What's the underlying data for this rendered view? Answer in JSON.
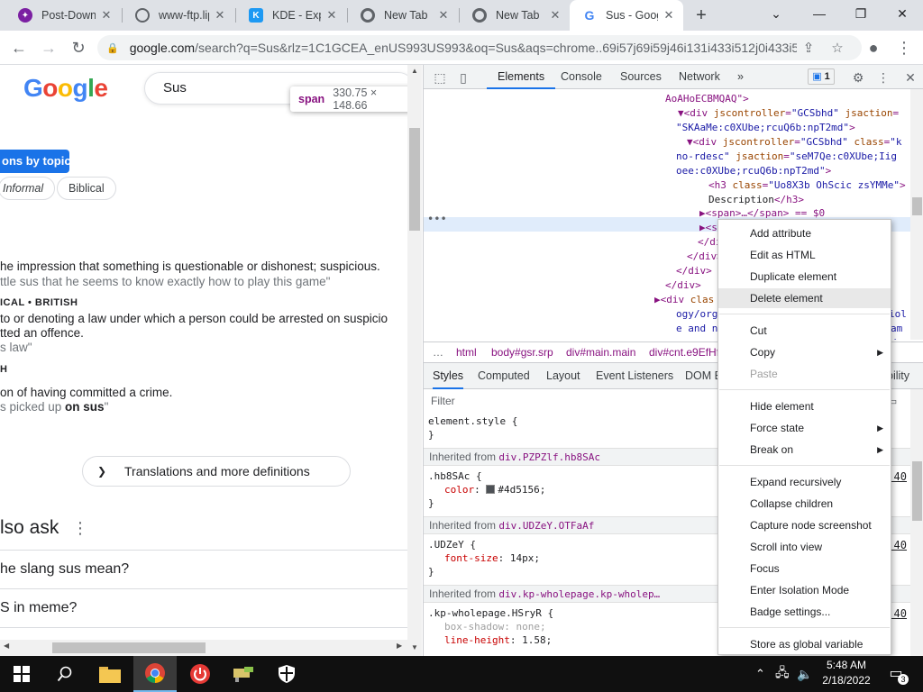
{
  "browser": {
    "tabs": [
      {
        "title": "Post-Down",
        "fav_color": "#7b1fa2"
      },
      {
        "title": "www-ftp.lip",
        "fav_color": "#5f6368"
      },
      {
        "title": "KDE - Expe",
        "fav_color": "#1d99f3"
      },
      {
        "title": "New Tab",
        "fav_color": "#5f6368"
      },
      {
        "title": "New Tab",
        "fav_color": "#5f6368"
      },
      {
        "title": "Sus - Goog",
        "fav_color": "#4285f4"
      }
    ],
    "active_tab_index": 5,
    "url_host": "google.com",
    "url_rest": "/search?q=Sus&rlz=1C1GCEA_enUS993US993&oq=Sus&aqs=chrome..69i57j69i59j46i131i433i512j0i433i5..."
  },
  "page": {
    "logo": "Google",
    "search_value": "Sus",
    "tooltip": {
      "tag": "span",
      "dims": "330.75 × 148.66"
    },
    "topic_button": "ons by topic",
    "chips": [
      "Informal",
      "Biblical"
    ],
    "definitions": [
      {
        "text": "he impression that something is questionable or dishonest; suspicious.",
        "kind": "def"
      },
      {
        "text": "ttle sus that he seems to know exactly how to play this game\"",
        "kind": "ex"
      },
      {
        "text": "ICAL • BRITISH",
        "kind": "lbl"
      },
      {
        "text": " to or denoting a law under which a person could be arrested on suspicio",
        "kind": "def"
      },
      {
        "text": "tted an offence.",
        "kind": "def"
      },
      {
        "text": "s law\"",
        "kind": "ex"
      },
      {
        "text": "H",
        "kind": "lbl"
      },
      {
        "text": "on of having committed a crime.",
        "kind": "def"
      },
      {
        "text": "s picked up ",
        "bold": "on sus",
        "tail": "\"",
        "kind": "ex"
      }
    ],
    "translations_button": "Translations and more definitions",
    "people_also_ask": "lso ask",
    "questions": [
      "he slang sus mean?",
      "S in meme?"
    ]
  },
  "devtools": {
    "tabs": [
      "Elements",
      "Console",
      "Sources",
      "Network"
    ],
    "active_tab": "Elements",
    "more_tabs": "»",
    "issues_count": "1",
    "dom_lines": [
      {
        "html": "AoAHoECBMQAQ\">"
      },
      {
        "html": "▼<span class=\"tg\">&lt;div</span> <span class=\"an\">jscontroller</span>=<span class=\"av\">\"GCSbhd\"</span> <span class=\"an\">jsaction</span>="
      },
      {
        "html": "<span class=\"av\">\"SKAaMe:c0XUbe;rcuQ6b:npT2md\"</span>&gt;"
      },
      {
        "html": "▼&lt;div <span class=\"an\">jscontroller</span>=<span class=\"av\">\"GCSbhd\"</span> <span class=\"an\">class</span>=<span class=\"av\">\"k</span>"
      },
      {
        "html": "<span class=\"av\">no-rdesc\"</span> <span class=\"an\">jsaction</span>=<span class=\"av\">\"seM7Qe:c0XUbe;Iig</span>"
      },
      {
        "html": "<span class=\"av\">oee:c0XUbe;rcuQ6b:npT2md\"</span>&gt;"
      },
      {
        "html": "&lt;h3 <span class=\"an\">class</span>=<span class=\"av\">\"Uo8X3b OhScic zsYMMe\"</span>&gt;"
      },
      {
        "html": "<span class=\"tx\">Description</span>&lt;/h3&gt;"
      },
      {
        "html": "▶&lt;span&gt;…&lt;/span&gt; == $0"
      },
      {
        "html": "▶&lt;s"
      },
      {
        "html": "&lt;/di"
      },
      {
        "html": "&lt;/div&gt;"
      },
      {
        "html": "&lt;/div&gt;"
      },
      {
        "html": "&lt;/div&gt;"
      },
      {
        "html": "▶&lt;div <span class=\"an\">clas</span>"
      },
      {
        "html": "<span class=\"av\">ogy/organis</span>"
      },
      {
        "html": "<span class=\"av\">e and neasi</span>"
      }
    ],
    "dom_right_lines": [
      "iol",
      "am",
      "d"
    ],
    "breadcrumbs": [
      "…",
      "html",
      "body#gsr.srp",
      "div#main.main",
      "div#cnt.e9EfHf"
    ],
    "style_tabs": [
      "Styles",
      "Computed",
      "Layout",
      "Event Listeners",
      "DOM B"
    ],
    "style_tab_tail": "bility",
    "filter_placeholder": "Filter",
    "element_style": "element.style {",
    "close_brace": "}",
    "inherited": [
      {
        "label": "Inherited from ",
        "link": "div.PZPZlf.hb8SAc"
      },
      {
        "label": "Inherited from ",
        "link": "div.UDZeY.OTFaAf"
      },
      {
        "label": "Inherited from ",
        "link": "div.kp-wholepage.kp-wholep…"
      }
    ],
    "rules": [
      {
        "selector": ".hb8SAc {",
        "prop": "color",
        "value": "#4d5156;"
      },
      {
        "selector": ".UDZeY {",
        "prop": "font-size",
        "value": "14px;"
      },
      {
        "selector": ".kp-wholepage.HSryR {",
        "prop": "box-shadow",
        "value": "none;",
        "prop2": "line-height",
        "value2": "1.58;"
      }
    ],
    "source_links": [
      ":40",
      ":40",
      ":40",
      ":40"
    ]
  },
  "context_menu": {
    "items": [
      {
        "label": "Add attribute"
      },
      {
        "label": "Edit as HTML"
      },
      {
        "label": "Duplicate element"
      },
      {
        "label": "Delete element",
        "highlight": true
      },
      {
        "sep": true
      },
      {
        "label": "Cut"
      },
      {
        "label": "Copy",
        "submenu": true
      },
      {
        "label": "Paste",
        "disabled": true
      },
      {
        "sep": true
      },
      {
        "label": "Hide element"
      },
      {
        "label": "Force state",
        "submenu": true
      },
      {
        "label": "Break on",
        "submenu": true
      },
      {
        "sep": true
      },
      {
        "label": "Expand recursively"
      },
      {
        "label": "Collapse children"
      },
      {
        "label": "Capture node screenshot"
      },
      {
        "label": "Scroll into view"
      },
      {
        "label": "Focus"
      },
      {
        "label": "Enter Isolation Mode"
      },
      {
        "label": "Badge settings..."
      },
      {
        "sep": true
      },
      {
        "label": "Store as global variable"
      }
    ]
  },
  "taskbar": {
    "time": "5:48 AM",
    "date": "2/18/2022",
    "notification_count": "3"
  }
}
